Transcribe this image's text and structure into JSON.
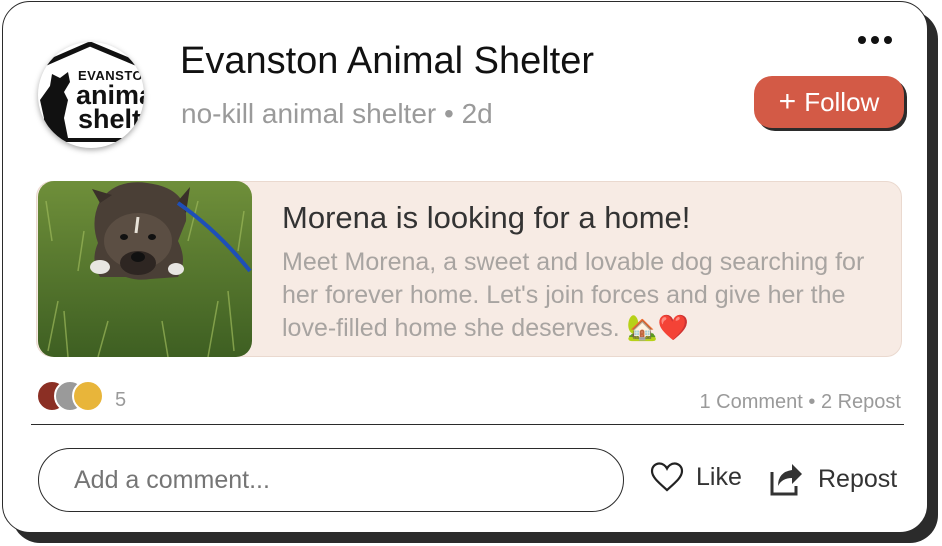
{
  "organization": {
    "name": "Evanston Animal Shelter",
    "subline": "no-kill animal shelter • 2d",
    "logo_text": [
      "EVANSTON",
      "animal",
      "shelter"
    ]
  },
  "header": {
    "follow_label": "Follow",
    "follow_icon": "plus-icon",
    "more_icon": "more-options-icon"
  },
  "post": {
    "title": "Morena is looking for a home!",
    "body": "Meet Morena, a sweet and lovable dog searching for her forever home. Let's join forces and give her the love-filled home she deserves. 🏡❤️",
    "image": "dog-photo"
  },
  "engagement": {
    "reaction_count": "5",
    "stats": "1 Comment • 2 Repost"
  },
  "actions": {
    "comment_placeholder": "Add a comment...",
    "like_label": "Like",
    "repost_label": "Repost"
  },
  "colors": {
    "accent": "#d35a46",
    "post_background": "#f7ebe4",
    "muted_text": "#9a9a9a"
  }
}
